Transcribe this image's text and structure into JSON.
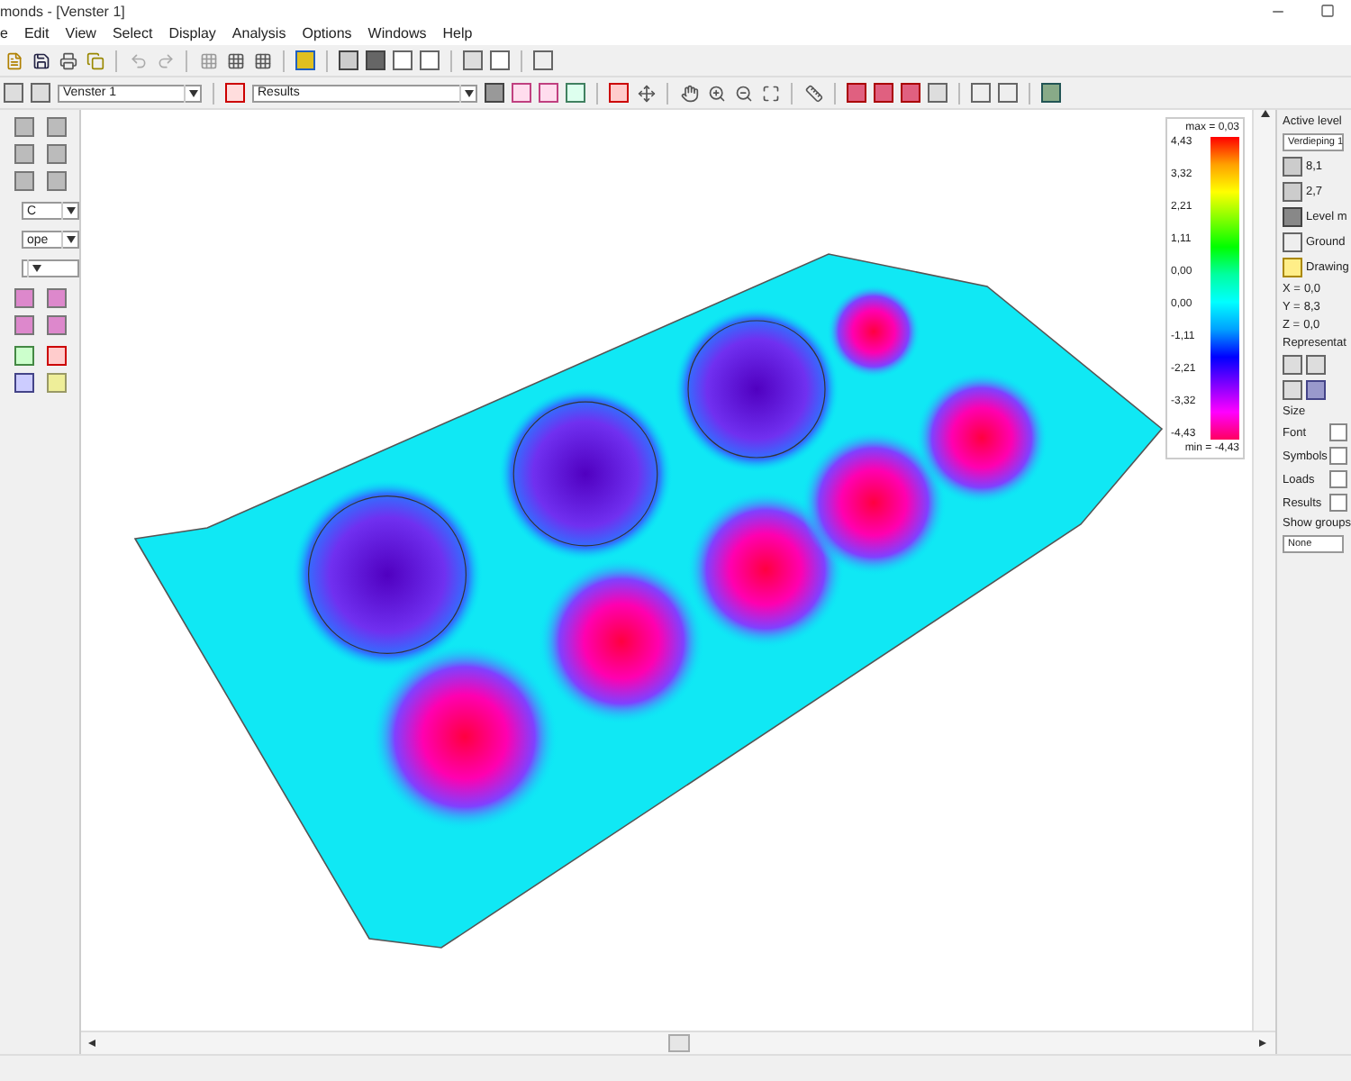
{
  "window": {
    "title": "monds - [Venster 1]"
  },
  "menu": [
    {
      "label": "e"
    },
    {
      "label": "Edit"
    },
    {
      "label": "View"
    },
    {
      "label": "Select"
    },
    {
      "label": "Display"
    },
    {
      "label": "Analysis"
    },
    {
      "label": "Options"
    },
    {
      "label": "Windows"
    },
    {
      "label": "Help"
    }
  ],
  "toolbar": {
    "view_select": "Venster 1",
    "result_select": "Results"
  },
  "left_panel": {
    "selects": [
      {
        "value": "C"
      },
      {
        "value": "ope"
      }
    ]
  },
  "legend": {
    "max": "max = 0,03",
    "ticks": [
      "4,43",
      "3,32",
      "2,21",
      "1,11",
      "0,00",
      "0,00",
      "-1,11",
      "-2,21",
      "-3,32",
      "-4,43"
    ],
    "min": "min = -4,43"
  },
  "right_panel": {
    "active_level_label": "Active level",
    "level_select": "Verdieping 1",
    "levels": [
      {
        "value": "8,1"
      },
      {
        "value": "2,7"
      }
    ],
    "level_manager": "Level m",
    "ground": "Ground",
    "drawing": "Drawing",
    "coords": [
      {
        "axis": "X =",
        "value": "0,0"
      },
      {
        "axis": "Y =",
        "value": "8,3"
      },
      {
        "axis": "Z =",
        "value": "0,0"
      }
    ],
    "representation_label": "Representat",
    "size_label": "Size",
    "size_rows": [
      {
        "label": "Font"
      },
      {
        "label": "Symbols"
      },
      {
        "label": "Loads"
      },
      {
        "label": "Results"
      }
    ],
    "groups_label": "Show groups",
    "groups_select": "None"
  }
}
